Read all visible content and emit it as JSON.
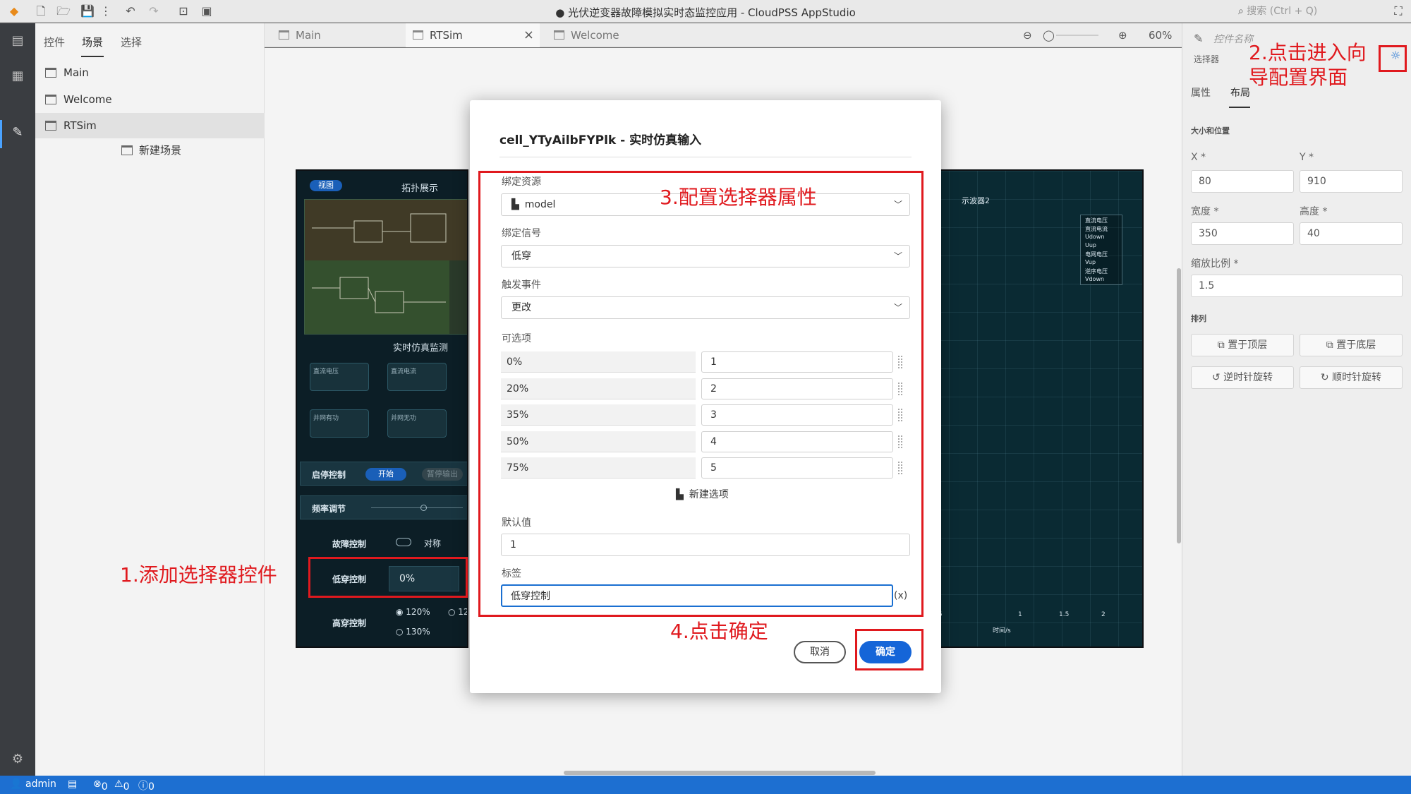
{
  "app": {
    "title": "光伏逆变器故障模拟实时态监控应用 - CloudPSS AppStudio",
    "search_placeholder": "搜索 (Ctrl + Q)"
  },
  "scene_panel": {
    "tabs": [
      "控件",
      "场景",
      "选择"
    ],
    "items": [
      "Main",
      "Welcome",
      "RTSim"
    ],
    "new_scene": "新建场景"
  },
  "editor": {
    "tabs": [
      "Main",
      "RTSim",
      "Welcome"
    ],
    "close_icon": "×",
    "zoom": "60%"
  },
  "dashboard": {
    "left_pill": "视图",
    "topo_title": "拓扑展示",
    "monitor_title": "实时仿真监测",
    "start_stop": "启停控制",
    "start_btn": "开始",
    "stop_btn": "暂停输出",
    "freq": "频率调节",
    "fault": "故障控制",
    "fault_opt": "对称",
    "lvrt": "低穿控制",
    "lvrt_value": "0%",
    "hvrt": "高穿控制",
    "hvrt_opt1": "120%",
    "hvrt_opt2": "130%",
    "hvrt_opt3": "12",
    "cards": [
      "直流电压",
      "直流电流",
      "并网有功",
      "并网无功"
    ],
    "scope_title": "示波器2",
    "x_axis": "时间/s",
    "x_ticks": [
      ".5",
      "1",
      "1.5",
      "2"
    ],
    "legend": [
      "直流电压",
      "直流电流",
      "Udown",
      "Uup",
      "电网电压",
      "Vup",
      "逆序电压",
      "Vdown"
    ]
  },
  "props": {
    "control_name": "控件名称",
    "control_type": "选择器",
    "tabs": [
      "属性",
      "布局"
    ],
    "section_size": "大小和位置",
    "x_label": "X *",
    "y_label": "Y *",
    "x": "80",
    "y": "910",
    "w_label": "宽度 *",
    "h_label": "高度 *",
    "w": "350",
    "h": "40",
    "scale_label": "缩放比例 *",
    "scale": "1.5",
    "arrange": "排列",
    "btn_top": "置于顶层",
    "btn_bottom": "置于底层",
    "btn_ccw": "逆时针旋转",
    "btn_cw": "顺时针旋转"
  },
  "modal": {
    "title": "cell_YTyAilbFYPlk - 实时仿真输入",
    "bind_resource_label": "绑定资源",
    "bind_resource": "model",
    "bind_signal_label": "绑定信号",
    "bind_signal": "低穿",
    "trigger_label": "触发事件",
    "trigger": "更改",
    "options_label": "可选项",
    "options": [
      {
        "label": "0%",
        "value": "1"
      },
      {
        "label": "20%",
        "value": "2"
      },
      {
        "label": "35%",
        "value": "3"
      },
      {
        "label": "50%",
        "value": "4"
      },
      {
        "label": "75%",
        "value": "5"
      }
    ],
    "new_option": "新建选项",
    "default_label": "默认值",
    "default": "1",
    "tag_label": "标签",
    "tag": "低穿控制",
    "expr_btn": "(x)",
    "cancel": "取消",
    "ok": "确定"
  },
  "annotations": {
    "a1": "1.添加选择器控件",
    "a2_line1": "2.点击进入向",
    "a2_line2": "导配置界面",
    "a3": "3.配置选择器属性",
    "a4": "4.点击确定"
  },
  "status": {
    "user": "admin",
    "errors": "0",
    "warnings": "0",
    "infos": "0"
  }
}
